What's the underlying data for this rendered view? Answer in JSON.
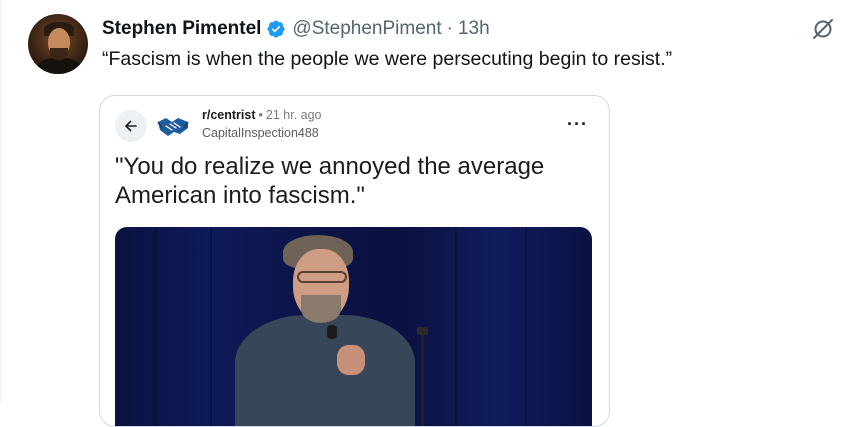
{
  "author": {
    "name": "Stephen Pimentel",
    "handle": "@StephenPiment",
    "separator": "·",
    "time": "13h"
  },
  "tweet": {
    "text": "“Fascism is when the people we were persecuting begin to resist.”"
  },
  "embedded_post": {
    "subreddit": "r/centrist",
    "separator": "•",
    "age": "21 hr. ago",
    "username": "CapitalInspection488",
    "more_label": "···",
    "title": "\"You do realize we annoyed the average American into fascism.\""
  },
  "icons": {
    "verified": "verified-badge-icon",
    "grok": "grok-icon",
    "back": "back-arrow-icon",
    "subreddit": "handshake-icon",
    "more": "more-options-icon"
  },
  "colors": {
    "verified": "#1d9bf0",
    "text_primary": "#0f1419",
    "text_secondary": "#536471",
    "card_border": "#cfd9de",
    "subreddit_icon": "#1f5c9e"
  }
}
